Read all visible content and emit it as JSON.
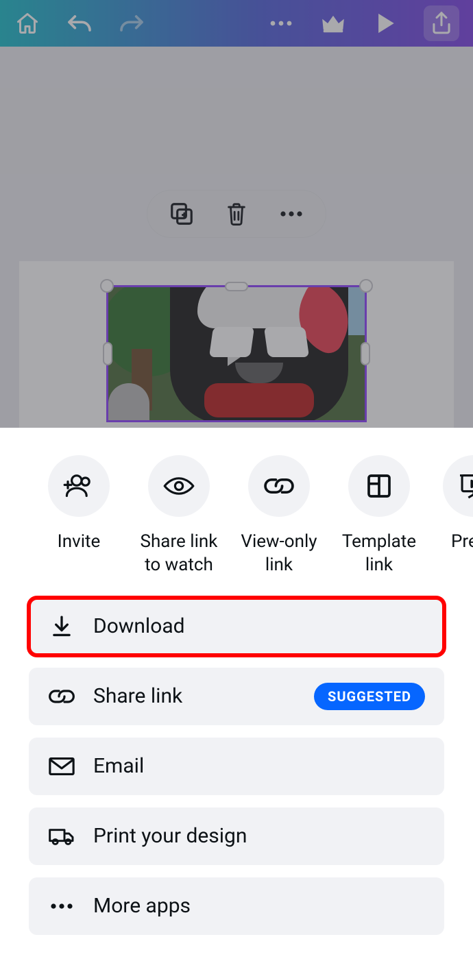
{
  "share_row": [
    {
      "label": "Invite"
    },
    {
      "label": "Share link\nto watch"
    },
    {
      "label": "View-only\nlink"
    },
    {
      "label": "Template\nlink"
    },
    {
      "label": "Prese"
    }
  ],
  "actions": {
    "download": "Download",
    "share_link": "Share link",
    "share_badge": "SUGGESTED",
    "email": "Email",
    "print": "Print your design",
    "more": "More apps"
  }
}
